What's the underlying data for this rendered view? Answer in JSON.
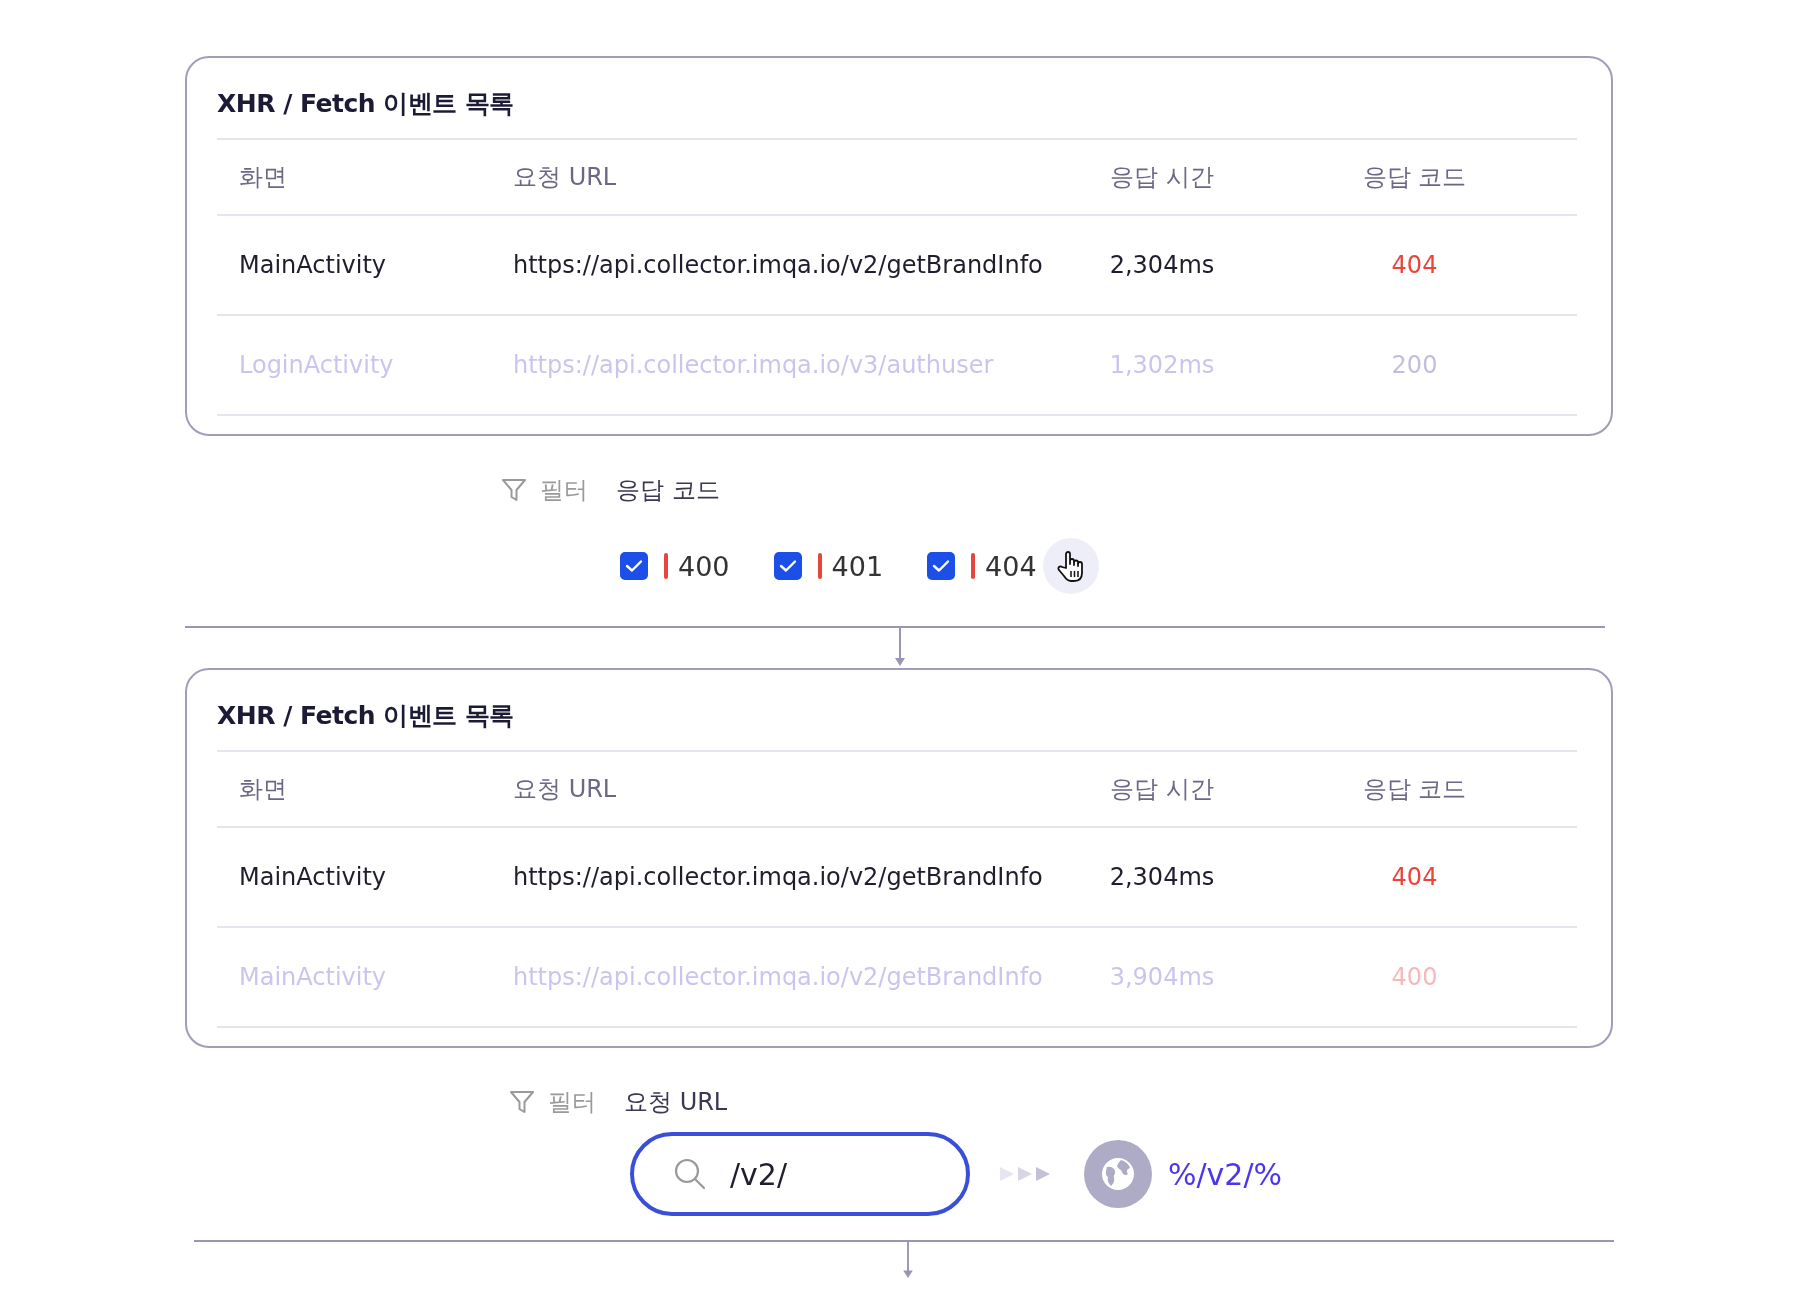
{
  "sections": [
    {
      "card": {
        "title": "XHR / Fetch 이벤트 목록",
        "columns": [
          "화면",
          "요청 URL",
          "응답 시간",
          "응답 코드"
        ],
        "rows": [
          {
            "screen": "MainActivity",
            "url": "https://api.collector.imqa.io/v2/getBrandInfo",
            "time": "2,304ms",
            "code": "404",
            "kind": "error",
            "dimmed": false
          },
          {
            "screen": "LoginActivity",
            "url": "https://api.collector.imqa.io/v3/authuser",
            "time": "1,302ms",
            "code": "200",
            "kind": "ok",
            "dimmed": true
          }
        ]
      },
      "filter": {
        "label": "필터",
        "field": "응답 코드",
        "kind": "checkboxes",
        "options": [
          {
            "label": "400",
            "checked": true,
            "hovered": false
          },
          {
            "label": "401",
            "checked": true,
            "hovered": false
          },
          {
            "label": "404",
            "checked": true,
            "hovered": true
          }
        ]
      }
    },
    {
      "card": {
        "title": "XHR / Fetch 이벤트 목록",
        "columns": [
          "화면",
          "요청 URL",
          "응답 시간",
          "응답 코드"
        ],
        "rows": [
          {
            "screen": "MainActivity",
            "url": "https://api.collector.imqa.io/v2/getBrandInfo",
            "time": "2,304ms",
            "code": "404",
            "kind": "error",
            "dimmed": false
          },
          {
            "screen": "MainActivity",
            "url": "https://api.collector.imqa.io/v2/getBrandInfo",
            "time": "3,904ms",
            "code": "400",
            "kind": "error",
            "dimmed": true
          }
        ]
      },
      "filter": {
        "label": "필터",
        "field": "요청 URL",
        "kind": "search",
        "value": "/v2/",
        "focused": true,
        "result": "%/v2/%"
      }
    }
  ]
}
